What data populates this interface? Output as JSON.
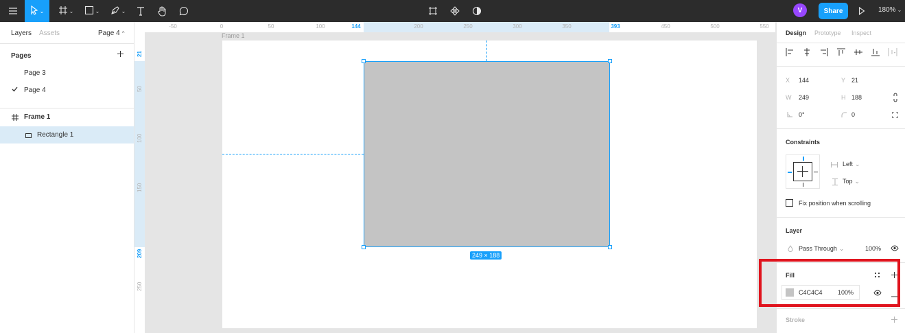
{
  "toolbar": {
    "menu_icon": "hamburger-menu-icon",
    "tools": [
      "move-tool-icon",
      "frame-tool-icon",
      "shape-tool-icon",
      "pen-tool-icon",
      "text-tool-icon",
      "hand-tool-icon",
      "comment-tool-icon"
    ],
    "center_tools": [
      "crop-icon",
      "component-icon",
      "contrast-icon"
    ],
    "avatar_initial": "V",
    "share_label": "Share",
    "zoom_label": "180%"
  },
  "left_panel": {
    "tabs": [
      "Layers",
      "Assets"
    ],
    "current_page_label": "Page 4",
    "pages_heading": "Pages",
    "pages": [
      "Page 3",
      "Page 4"
    ],
    "layers": [
      {
        "name": "Frame 1"
      },
      {
        "name": "Rectangle 1"
      }
    ]
  },
  "rulers": {
    "top_ticks": [
      "-50",
      "0",
      "50",
      "100",
      "144",
      "200",
      "250",
      "300",
      "350",
      "393",
      "450",
      "500",
      "550"
    ],
    "left_ticks": [
      "21",
      "50",
      "100",
      "150",
      "209",
      "250"
    ]
  },
  "canvas": {
    "frame_label": "Frame 1",
    "rect_fill": "#C4C4C4",
    "selection_color": "#18A0FB",
    "dimension_label": "249 × 188"
  },
  "right_panel": {
    "tabs": [
      "Design",
      "Prototype",
      "Inspect"
    ],
    "position": {
      "x_label": "X",
      "x": "144",
      "y_label": "Y",
      "y": "21",
      "w_label": "W",
      "w": "249",
      "h_label": "H",
      "h": "188",
      "rotation": "0°",
      "radius": "0"
    },
    "constraints": {
      "heading": "Constraints",
      "horizontal": "Left",
      "vertical": "Top",
      "fix_label": "Fix position when scrolling"
    },
    "layer": {
      "heading": "Layer",
      "blend": "Pass Through",
      "opacity": "100%"
    },
    "fill": {
      "heading": "Fill",
      "hex": "C4C4C4",
      "opacity": "100%",
      "swatch": "#C4C4C4"
    },
    "stroke": {
      "heading": "Stroke"
    }
  },
  "highlight_color": "#E0141E"
}
